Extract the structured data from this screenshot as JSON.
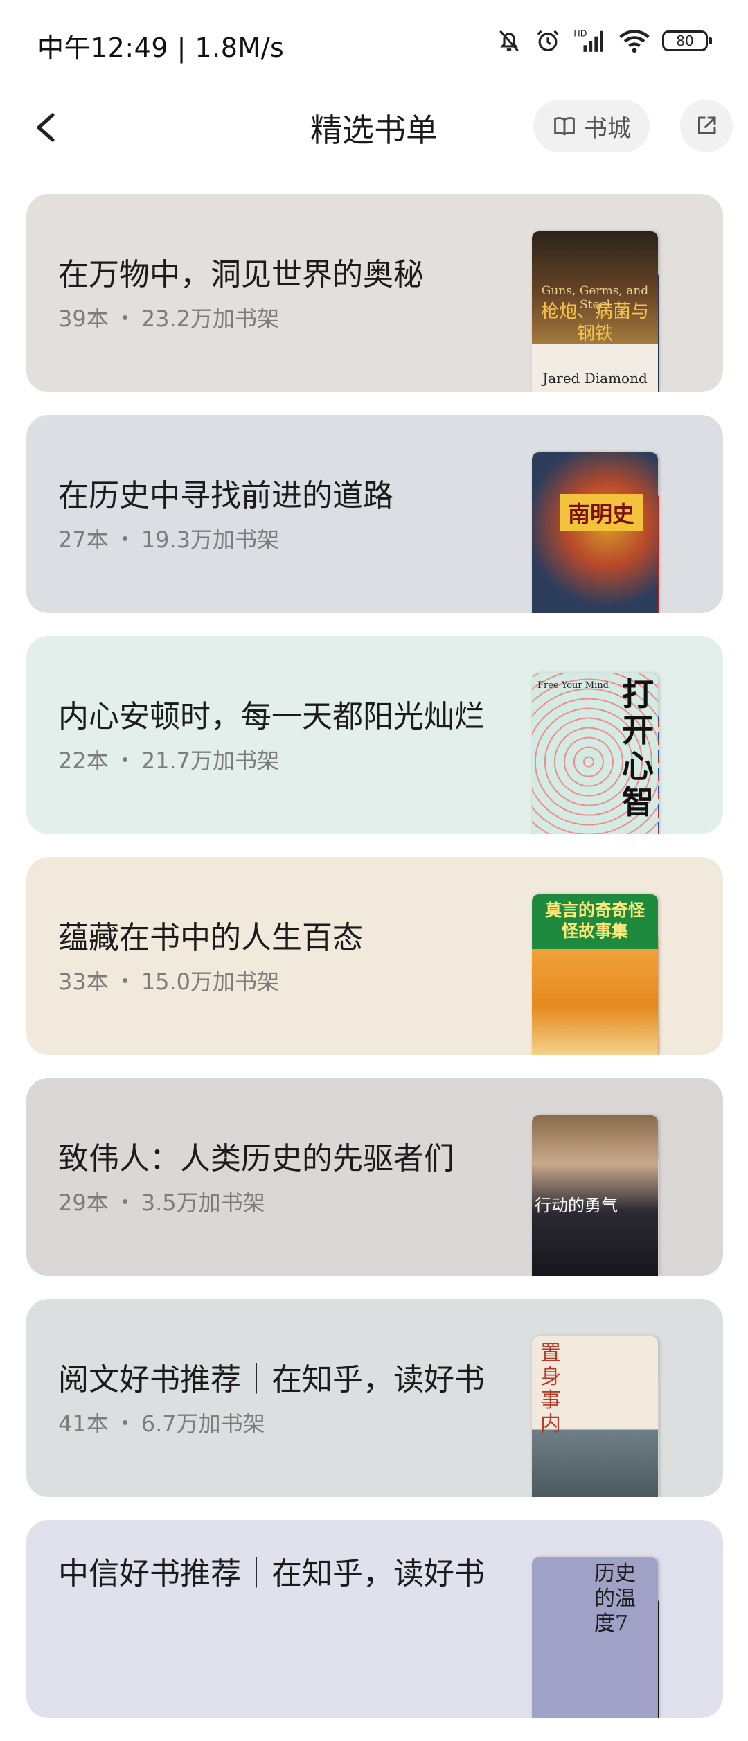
{
  "status_bar": {
    "time_speed": "中午12:49 | 1.8M/s",
    "battery": "80"
  },
  "header": {
    "title": "精选书单",
    "store_label": "书城"
  },
  "cards": [
    {
      "title": "在万物中，洞见世界的奥秘",
      "count": "39本",
      "adds": "23.2万加书架",
      "bg": "#e2dfdd",
      "cover": {
        "top": "Guns, Germs, and Steel",
        "cn": "枪炮、病菌与钢铁",
        "author": "Jared Diamond"
      },
      "colors": [
        "#5a3a22",
        "#ece7df",
        "#2e3d5c"
      ]
    },
    {
      "title": "在历史中寻找前进的道路",
      "count": "27本",
      "adds": "19.3万加书架",
      "bg": "#dcdee3",
      "cover": {
        "cn": "南明史"
      },
      "colors": [
        "#2c3d5c",
        "#8e2b2b",
        "#c7302b"
      ]
    },
    {
      "title": "内心安顿时，每一天都阳光灿烂",
      "count": "22本",
      "adds": "21.7万加书架",
      "bg": "#e2efeb",
      "cover": {
        "top": "Free Your Mind",
        "cn": "打开心智"
      },
      "colors": [
        "#d4ebe3",
        "#f2d33d",
        "#2a58b8"
      ]
    },
    {
      "title": "蕴藏在书中的人生百态",
      "count": "33本",
      "adds": "15.0万加书架",
      "bg": "#f2e9dd",
      "cover": {
        "cn": "莫言的奇奇怪怪故事集"
      },
      "colors": [
        "#1e8a3d",
        "#f7f4ef",
        "#efc89a"
      ]
    },
    {
      "title": "致伟人：人类历史的先驱者们",
      "count": "29本",
      "adds": "3.5万加书架",
      "bg": "#dbd7d6",
      "cover": {
        "cn": "行动的勇气"
      },
      "colors": [
        "#2b2a33",
        "#1f86d6",
        "#f5f5f5"
      ]
    },
    {
      "title": "阅文好书推荐｜在知乎，读好书",
      "count": "41本",
      "adds": "6.7万加书架",
      "bg": "#dcdfdf",
      "cover": {
        "cn": "置身事内"
      },
      "colors": [
        "#f1e9dc",
        "#d1b69a",
        "#f3f3f3"
      ]
    },
    {
      "title": "中信好书推荐｜在知乎，读好书",
      "count": "",
      "adds": "",
      "bg": "#e0e1ec",
      "cover": {
        "cn": "历史的温度7"
      },
      "colors": [
        "#9fa2c6",
        "#f4f4f4",
        "#1b1b1b"
      ]
    }
  ]
}
